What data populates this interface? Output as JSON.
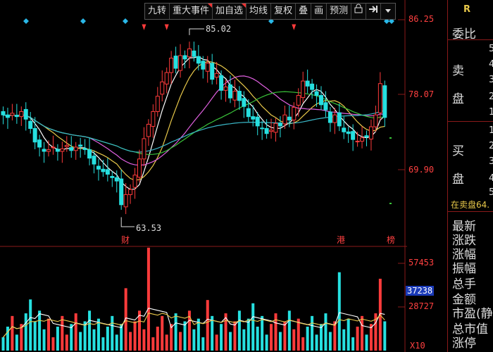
{
  "toolbar": {
    "items": [
      "九转",
      "重大事件",
      "加自选",
      "均线",
      "复权",
      "叠",
      "画",
      "预测"
    ],
    "lock_icon": "lock-icon",
    "arrow_icon": "arrow-right-icon",
    "menu_icon": "caret-down-icon"
  },
  "price_axis": {
    "top": "86.25",
    "mid": "78.07",
    "low": "69.90"
  },
  "price_marks": {
    "high": "85.02",
    "low": "63.53"
  },
  "event_markers": {
    "cai": "财",
    "gang": "港",
    "bang": "榜"
  },
  "volume_axis": {
    "top": "57453",
    "highlight": "37238",
    "mid": "28727",
    "unit": "X10"
  },
  "right_panel": {
    "header": "R",
    "weibi": "委比",
    "sell_label_1": "卖",
    "sell_label_2": "盘",
    "sell_levels": [
      "5",
      "4",
      "3",
      "2",
      "1"
    ],
    "buy_label_1": "买",
    "buy_label_2": "盘",
    "buy_levels": [
      "1",
      "2",
      "3",
      "4",
      "5"
    ],
    "current_order": "在卖盘64.",
    "stats": [
      "最新",
      "涨跌",
      "涨幅",
      "振幅",
      "总手",
      "金额",
      "市盈(静",
      "总市值",
      "涨停"
    ]
  },
  "colors": {
    "up": "#ff3b3b",
    "down": "#26e0e0",
    "ma5": "#ffffff",
    "ma10": "#e8c84a",
    "ma20": "#e060e0",
    "ma30": "#3ac43a",
    "ma60": "#3ab8c8",
    "grid": "#8a1a1a"
  },
  "chart_data": {
    "type": "candlestick",
    "y_range": [
      63.53,
      86.25
    ],
    "price_high": 85.02,
    "price_low": 63.53,
    "closes": [
      75.6,
      75.3,
      75.8,
      75.4,
      76.0,
      75.1,
      74.0,
      72.4,
      71.8,
      71.3,
      71.5,
      71.8,
      71.3,
      71.6,
      72.0,
      71.4,
      71.8,
      71.9,
      71.5,
      70.5,
      69.8,
      69.2,
      68.9,
      68.6,
      68.2,
      67.8,
      65.0,
      66.2,
      66.8,
      68.5,
      70.4,
      72.8,
      74.5,
      76.0,
      77.8,
      79.5,
      80.6,
      82.3,
      81.1,
      82.6,
      82.2,
      83.4,
      82.5,
      81.7,
      81.0,
      81.7,
      79.8,
      80.5,
      78.5,
      78.9,
      77.6,
      78.4,
      77.3,
      76.6,
      75.4,
      75.1,
      74.3,
      74.0,
      73.4,
      73.8,
      74.6,
      74.3,
      75.6,
      75.0,
      76.5,
      77.9,
      79.6,
      79.0,
      78.6,
      77.9,
      76.8,
      76.2,
      74.7,
      75.6,
      74.3,
      73.6,
      73.4,
      72.7,
      72.5,
      72.9,
      73.0,
      74.2,
      75.6,
      79.3,
      75.3
    ]
  }
}
